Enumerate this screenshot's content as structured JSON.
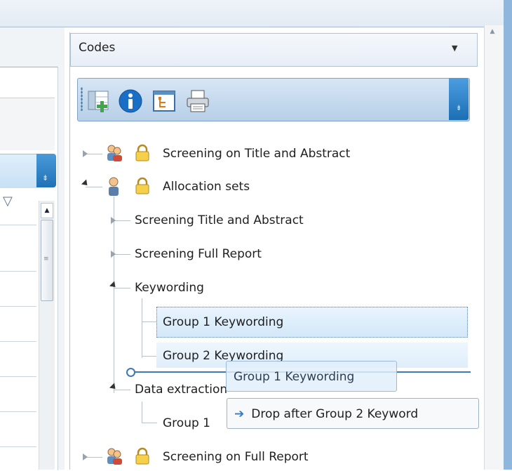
{
  "codes_panel": {
    "title": "Codes",
    "dropdown_glyph": "▼",
    "toolbar": {
      "buttons": [
        {
          "icon": "add-code-set-icon"
        },
        {
          "icon": "info-icon"
        },
        {
          "icon": "code-tree-view-icon"
        },
        {
          "icon": "print-icon"
        }
      ]
    },
    "tree": {
      "items": [
        {
          "label": "Screening on Title and Abstract",
          "expanded": false
        },
        {
          "label": "Allocation sets",
          "expanded": true
        },
        {
          "label": "Screening Title and Abstract",
          "expanded": false
        },
        {
          "label": "Screening Full Report",
          "expanded": false
        },
        {
          "label": "Keywording",
          "expanded": true
        },
        {
          "label": "Group 1 Keywording",
          "selected": true
        },
        {
          "label": "Group 2 Keywording"
        },
        {
          "label": "Data extraction",
          "expanded": true
        },
        {
          "label": "Group 1"
        },
        {
          "label": "Screening on Full Report",
          "expanded": false
        }
      ]
    }
  },
  "drag": {
    "ghost_label": "Group 1 Keywording",
    "drop_hint": "Drop after Group 2 Keyword"
  },
  "colors": {
    "accent_blue": "#1f72b6",
    "selection": "#d3e8f9",
    "drop_line": "#3d7ab4"
  }
}
